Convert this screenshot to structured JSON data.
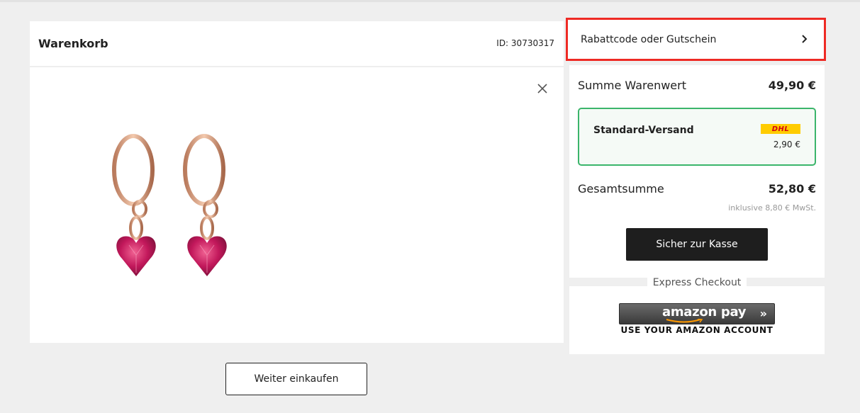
{
  "cart": {
    "title": "Warenkorb",
    "id_label": "ID: 30730317"
  },
  "product": {
    "image_alt": "Ohrringe mit Herz-Anhänger",
    "colors": {
      "metal": "#d39a7c",
      "stone": "#c2185b"
    }
  },
  "continue_label": "Weiter einkaufen",
  "coupon": {
    "label": "Rabattcode oder Gutschein"
  },
  "summary": {
    "subtotal_label": "Summe Warenwert",
    "subtotal_value": "49,90 €",
    "shipping": {
      "name": "Standard-Versand",
      "carrier": "DHL",
      "price": "2,90  €"
    },
    "total_label": "Gesamtsumme",
    "total_value": "52,80 €",
    "vat_note": "inklusive 8,80 € MwSt.",
    "checkout_label": "Sicher zur Kasse"
  },
  "express": {
    "label": "Express Checkout",
    "amazon_label": "amazon pay",
    "amazon_sub": "USE YOUR AMAZON ACCOUNT"
  },
  "icons": {
    "close": "close-icon",
    "chevron": "chevron-right-icon",
    "arrows": "double-chevron-icon"
  },
  "colors": {
    "highlight": "#ee2a24",
    "shipping_border": "#3bb56b",
    "checkout_bg": "#1e1e1e",
    "dhl_yellow": "#ffcc00",
    "dhl_red": "#d40511"
  }
}
